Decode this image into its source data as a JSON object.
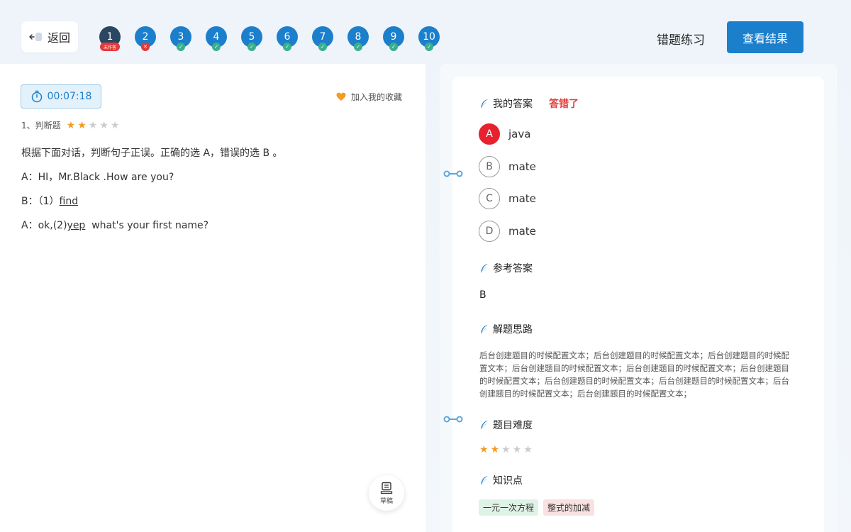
{
  "header": {
    "back_label": "返回",
    "practice_title": "错题练习",
    "result_button": "查看结果",
    "questions": [
      {
        "num": "1",
        "status": "unanswered",
        "badge": "未作答"
      },
      {
        "num": "2",
        "status": "wrong",
        "badge": "✕"
      },
      {
        "num": "3",
        "status": "correct",
        "badge": "✓"
      },
      {
        "num": "4",
        "status": "correct",
        "badge": "✓"
      },
      {
        "num": "5",
        "status": "correct",
        "badge": "✓"
      },
      {
        "num": "6",
        "status": "correct",
        "badge": "✓"
      },
      {
        "num": "7",
        "status": "correct",
        "badge": "✓"
      },
      {
        "num": "8",
        "status": "correct",
        "badge": "✓"
      },
      {
        "num": "9",
        "status": "correct",
        "badge": "✓"
      },
      {
        "num": "10",
        "status": "correct",
        "badge": "✓"
      }
    ]
  },
  "left": {
    "timer": "00:07:18",
    "favorite_label": "加入我的收藏",
    "question_type": "1、判断题",
    "question_stars": 2,
    "question_lines": [
      "根据下面对话，判断句子正误。正确的选 A，错误的选 B 。"
    ],
    "dialog": {
      "line1": "A：HI，Mr.Black .How are  you?",
      "line2_prefix": "B：（1）",
      "line2_underline": "find",
      "line3_prefix": "A：ok,(2)",
      "line3_underline": "yep",
      "line3_suffix": "  what's your first name?"
    },
    "draft_label": "草稿"
  },
  "right": {
    "my_answer_title": "我的答案",
    "wrong_label": "答错了",
    "options": [
      {
        "letter": "A",
        "text": "java",
        "chosen": true
      },
      {
        "letter": "B",
        "text": "mate",
        "chosen": false
      },
      {
        "letter": "C",
        "text": "mate",
        "chosen": false
      },
      {
        "letter": "D",
        "text": "mate",
        "chosen": false
      }
    ],
    "ref_answer_title": "参考答案",
    "ref_answer": "B",
    "analysis_title": "解题思路",
    "analysis_text": "后台创建题目的时候配置文本；后台创建题目的时候配置文本；后台创建题目的时候配置文本；后台创建题目的时候配置文本；后台创建题目的时候配置文本；后台创建题目的时候配置文本；后台创建题目的时候配置文本；后台创建题目的时候配置文本；后台创建题目的时候配置文本；后台创建题目的时候配置文本；",
    "difficulty_title": "题目难度",
    "difficulty_stars": 2,
    "knowledge_title": "知识点",
    "tags": [
      "一元一次方程",
      "整式的加减"
    ]
  },
  "colors": {
    "primary": "#1b7fcc",
    "current_question": "#2a4661",
    "wrong": "#e43a3a",
    "correct": "#3ab08a",
    "star": "#f59a23"
  }
}
